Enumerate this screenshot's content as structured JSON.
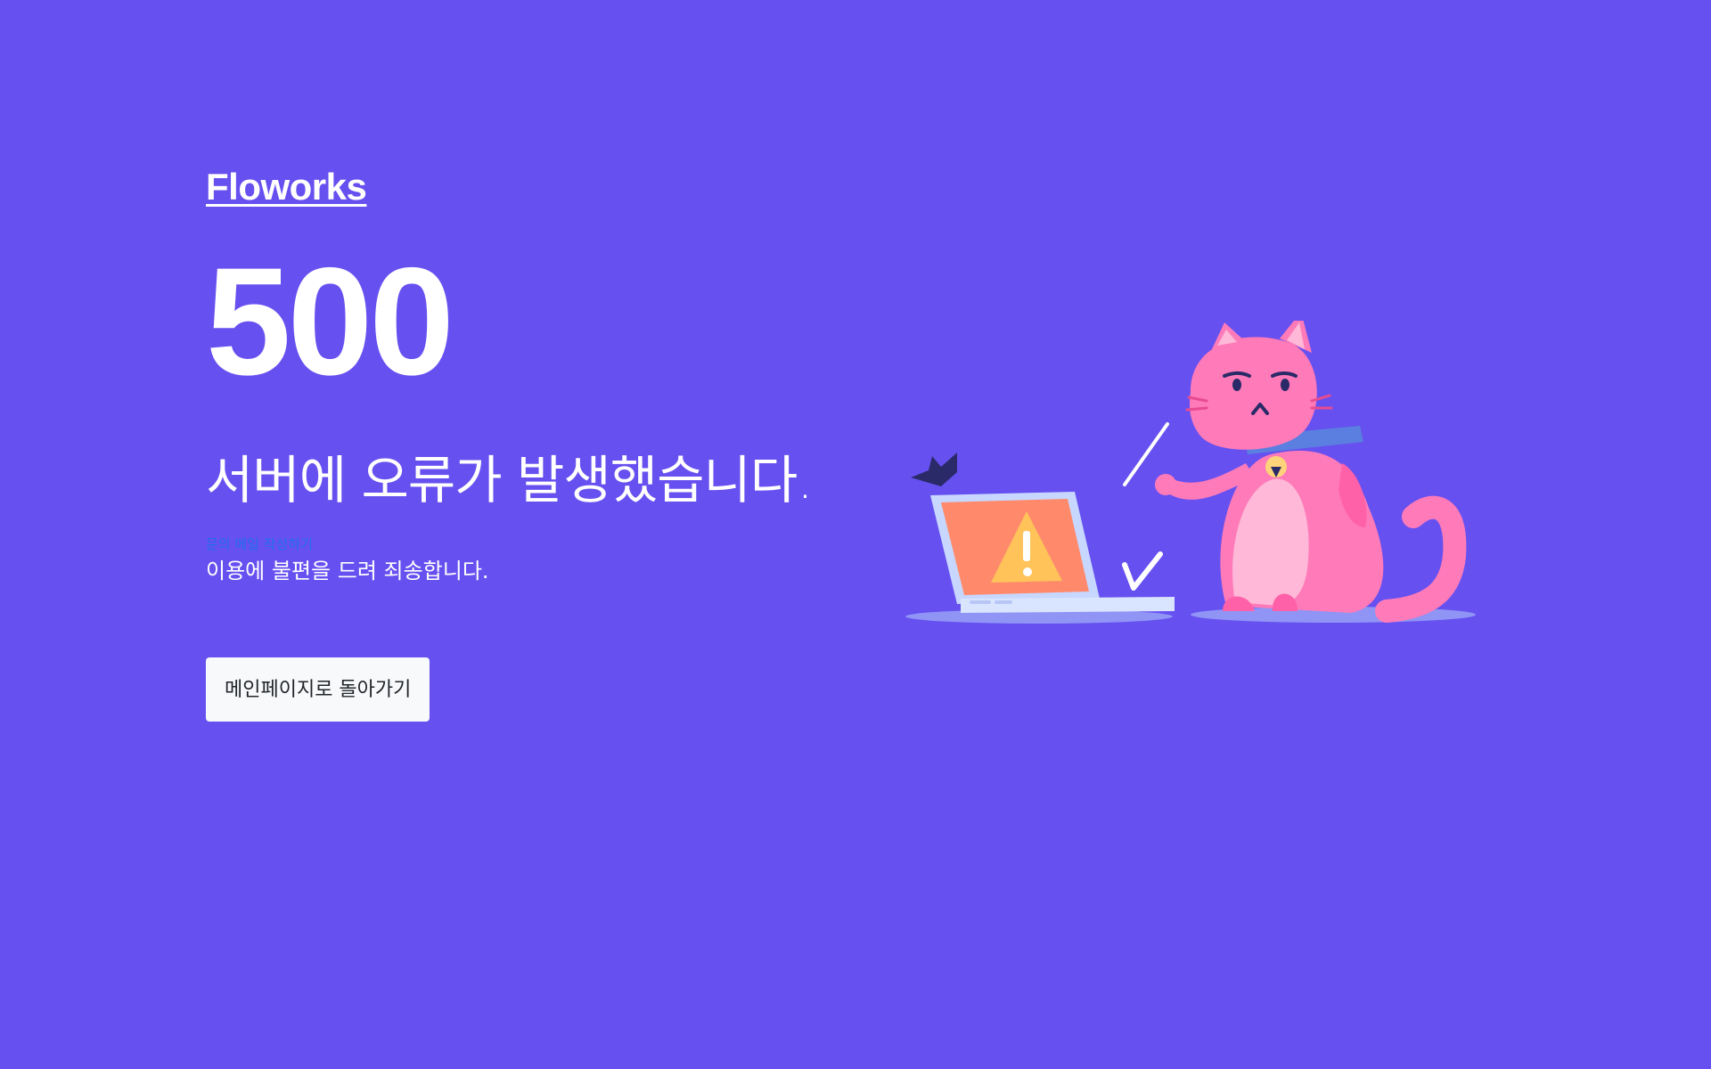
{
  "brand": {
    "name": "Floworks"
  },
  "error": {
    "code": "500",
    "title": "서버에 오류가 발생했습니다.",
    "mail_link": "문의 메일 작성하기",
    "apology": "이용에 불편을 드려 죄송합니다."
  },
  "actions": {
    "home_button": "메인페이지로 돌아가기"
  },
  "illustration": {
    "subject": "cat-with-broken-laptop",
    "icons": [
      "warning-icon",
      "check-icon"
    ]
  },
  "colors": {
    "background": "#6750f0",
    "text": "#ffffff",
    "link": "#1f6feb",
    "button_bg": "#f8f9fa",
    "button_text": "#212529",
    "cat_body": "#ff7ab8",
    "laptop_screen": "#ff8a6b",
    "warning": "#ffc35a",
    "collar": "#5a7fe0"
  }
}
